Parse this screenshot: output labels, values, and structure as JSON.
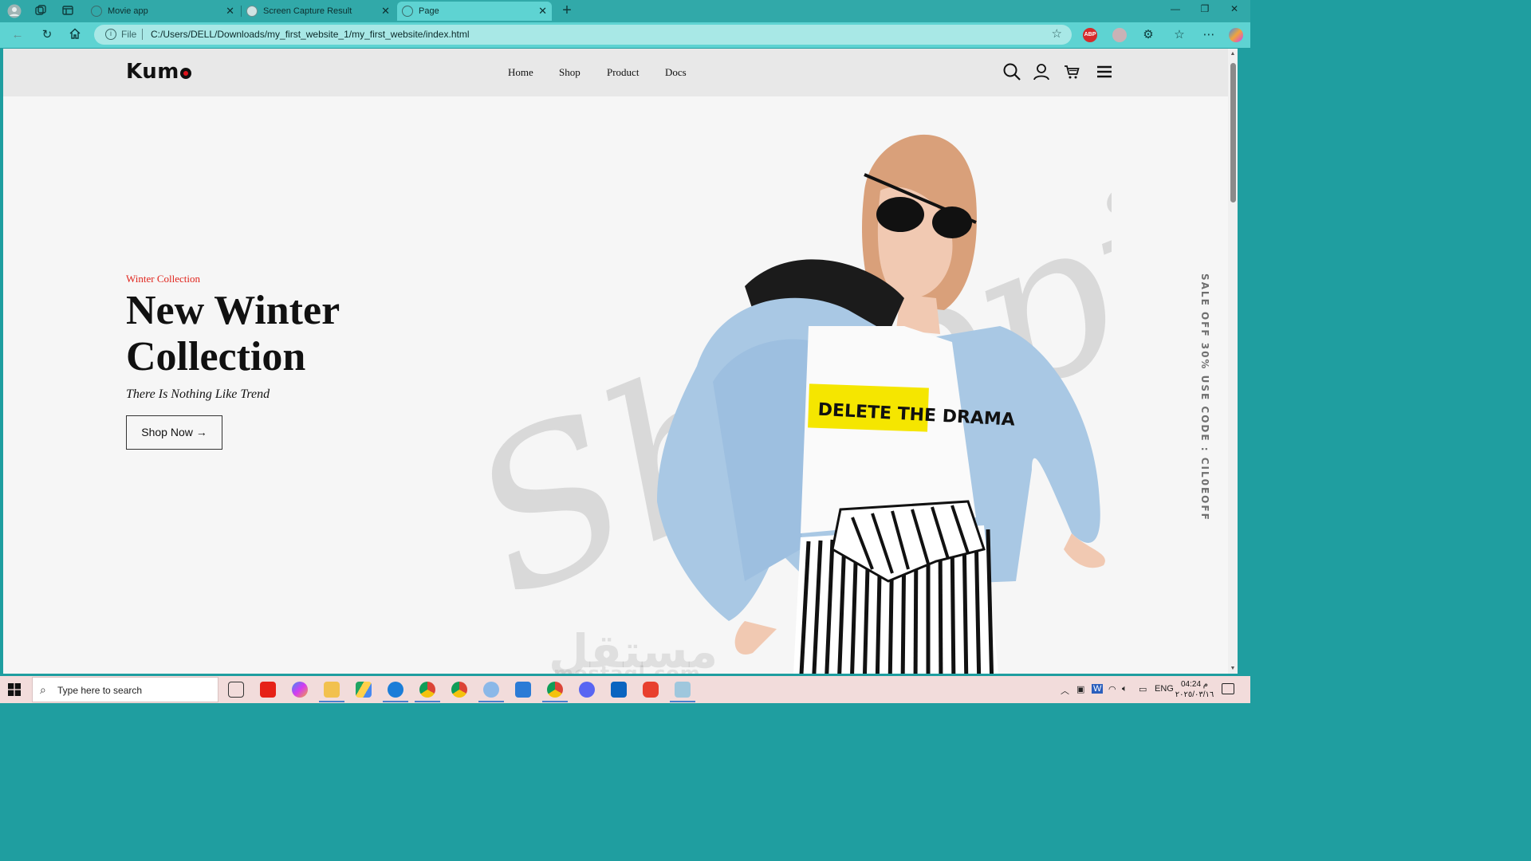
{
  "browser": {
    "tabs": [
      {
        "label": "Movie app",
        "active": false
      },
      {
        "label": "Screen Capture Result",
        "active": false
      },
      {
        "label": "Page",
        "active": true
      }
    ],
    "address": {
      "scheme_label": "File",
      "url": "C:/Users/DELL/Downloads/my_first_website_1/my_first_website/index.html"
    },
    "extensions": [
      "adblock-icon",
      "record-icon",
      "extensions-icon",
      "favorites-icon",
      "more-icon",
      "copilot-icon"
    ],
    "adblock_label": "ABP"
  },
  "site": {
    "logo": "Kum",
    "nav": [
      "Home",
      "Shop",
      "Product",
      "Docs"
    ],
    "icons": [
      "search-icon",
      "user-icon",
      "cart-icon",
      "menu-icon"
    ],
    "hero": {
      "tag": "Winter Collection",
      "title": "New Winter Collection",
      "subtitle": "There Is Nothing Like Trend",
      "button": "Shop Now →",
      "tshirt_text": "DELETE THE DRAMA",
      "script_word": "Shopping"
    },
    "sale_banner": "SALE OFF 30% USE CODE : CIL0EOFF",
    "accent_color": "#e0241c"
  },
  "watermark": {
    "arabic": "مستقل",
    "latin": "mostaql.com"
  },
  "taskbar": {
    "search_placeholder": "Type here to search",
    "language": "ENG",
    "time": "04:24 م",
    "date": "٢٠٢٥/٠٣/١٦"
  }
}
